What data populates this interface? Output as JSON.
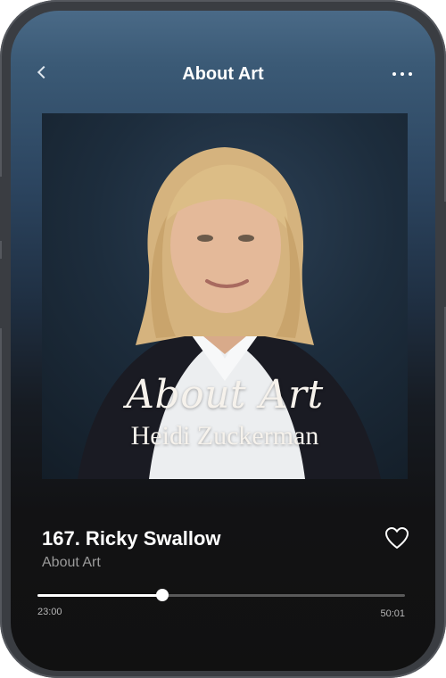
{
  "header": {
    "title": "About Art",
    "back_icon": "chevron-left-icon",
    "more_icon": "more-horizontal-icon"
  },
  "cover": {
    "show_title": "About Art",
    "host_name": "Heidi Zuckerman"
  },
  "episode": {
    "title": "167. Ricky Swallow",
    "show": "About Art",
    "favorite_icon": "heart-outline-icon"
  },
  "player": {
    "progress_fraction": 0.34,
    "elapsed": "23:00",
    "total": "50:01"
  },
  "colors": {
    "accent": "#ffffff",
    "muted_text": "#9b9b9b",
    "background_top": "#4a6a87",
    "background_bottom": "#111111"
  }
}
